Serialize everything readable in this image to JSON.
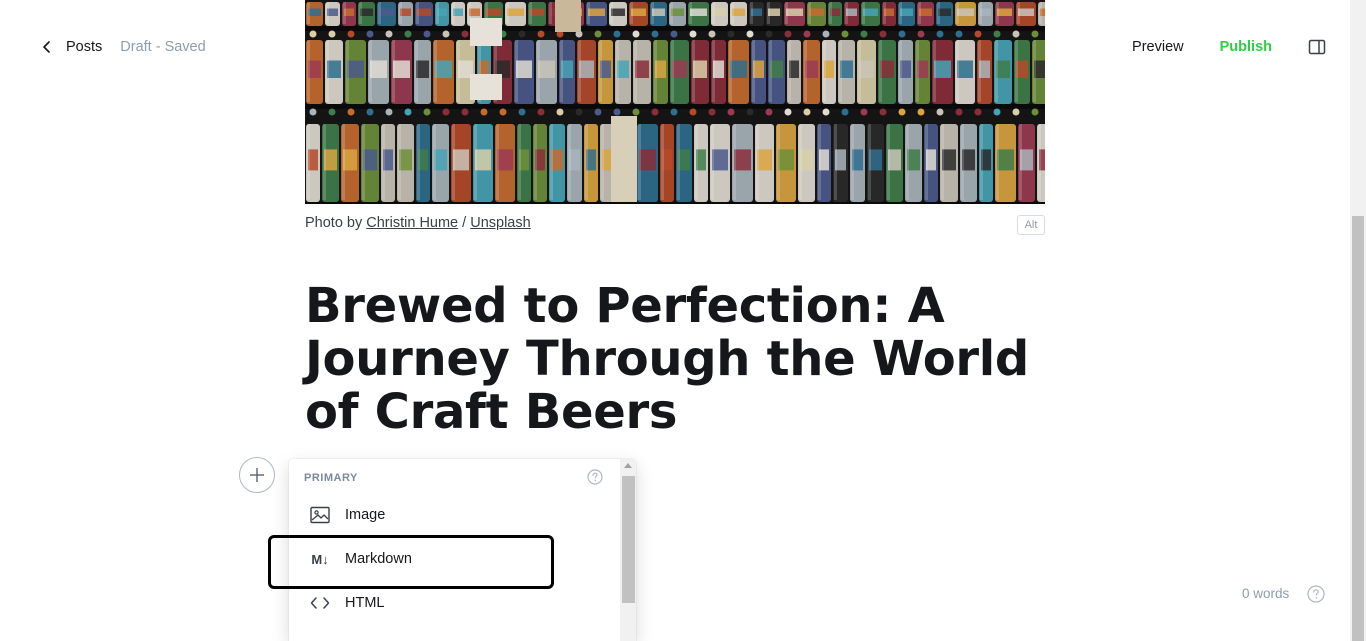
{
  "topbar": {
    "back_label": "Posts",
    "status": "Draft - Saved",
    "preview_label": "Preview",
    "publish_label": "Publish"
  },
  "caption": {
    "prefix": "Photo by ",
    "author": "Christin Hume",
    "separator": " / ",
    "source": "Unsplash",
    "alt_label": "Alt"
  },
  "post": {
    "title": "Brewed to Perfection: A Journey Through the World of Craft Beers"
  },
  "card_menu": {
    "heading": "PRIMARY",
    "items": [
      {
        "label": "Image",
        "icon": "image-icon"
      },
      {
        "label": "Markdown",
        "icon": "markdown-icon",
        "icon_text": "M↓"
      },
      {
        "label": "HTML",
        "icon": "code-icon"
      }
    ]
  },
  "footer": {
    "word_count": "0 words"
  },
  "colors": {
    "publish": "#30cf43",
    "muted": "#8e9cac",
    "text": "#15171a"
  }
}
